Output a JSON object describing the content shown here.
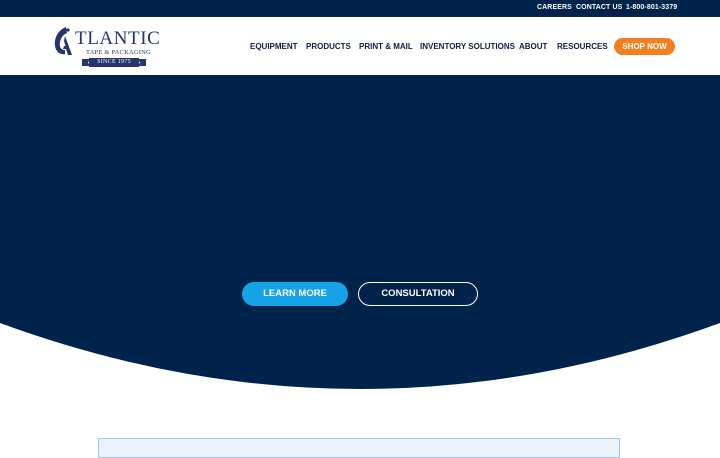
{
  "topbar": {
    "careers": "CAREERS",
    "contact": "CONTACT US",
    "phone": "1-800-801-3379"
  },
  "logo": {
    "word": "TLANTIC",
    "subtitle": "TAPE & PACKAGING",
    "since": "SINCE 1975"
  },
  "nav": {
    "equipment": "EQUIPMENT",
    "products": "PRODUCTS",
    "print_mail": "PRINT & MAIL",
    "inventory": "INVENTORY SOLUTIONS",
    "about": "ABOUT",
    "resources": "RESOURCES",
    "shop": "SHOP NOW"
  },
  "hero": {
    "learn_more": "LEARN MORE",
    "consultation": "CONSULTATION"
  },
  "colors": {
    "navy": "#00234b",
    "orange": "#f47f20",
    "sky": "#15a2e6"
  }
}
